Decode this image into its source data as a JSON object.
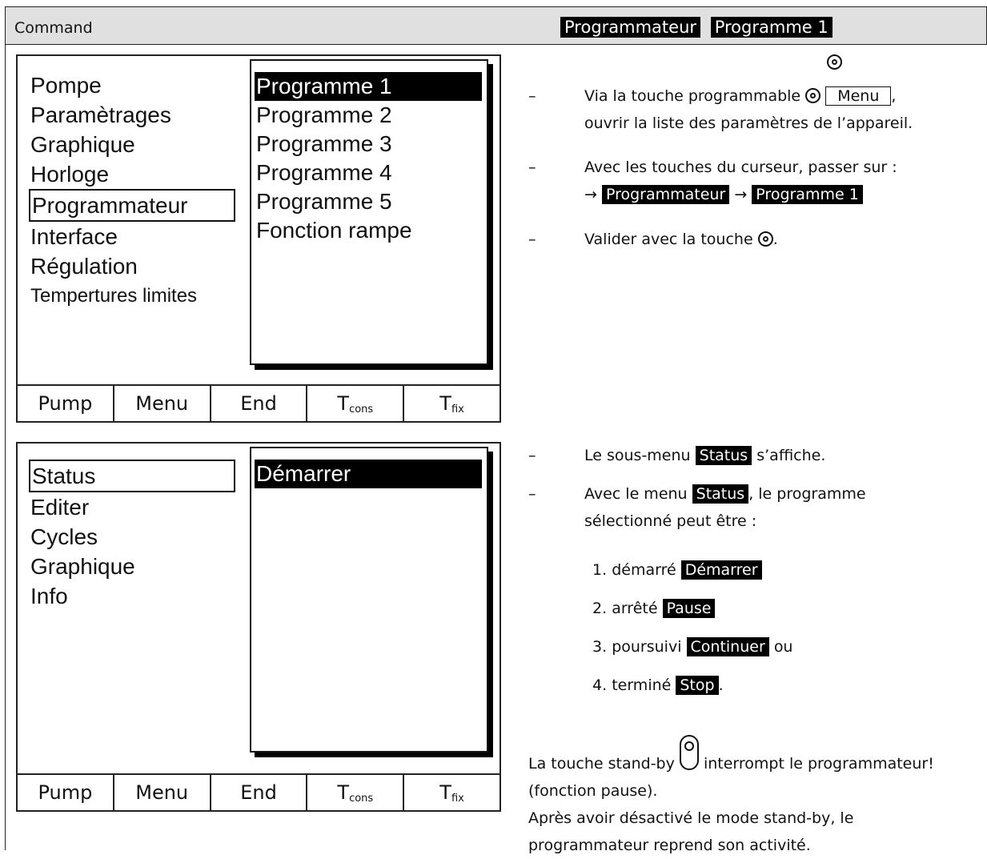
{
  "header": {
    "title": "Command",
    "path": [
      "Programmateur",
      "Programme 1"
    ]
  },
  "panel1": {
    "menu": [
      "Pompe",
      "Paramètrages",
      "Graphique",
      "Horloge",
      "Programmateur",
      "Interface",
      "Régulation",
      "Tempertures limites"
    ],
    "selected_index": 4,
    "submenu": [
      "Programme 1",
      "Programme 2",
      "Programme 3",
      "Programme 4",
      "Programme 5",
      "Fonction rampe"
    ],
    "highlighted_index": 0
  },
  "panel2": {
    "menu": [
      "Status",
      "Editer",
      "Cycles",
      "Graphique",
      "Info"
    ],
    "selected_index": 0,
    "submenu": [
      "Démarrer"
    ],
    "highlighted_index": 0
  },
  "softkeys": {
    "pump": "Pump",
    "menu": "Menu",
    "end": "End",
    "tcons_main": "T",
    "tcons_sub": "cons",
    "tfix_main": "T",
    "tfix_sub": "fix"
  },
  "instructions1": {
    "dash": "–",
    "step1_a": "Via la touche programmable",
    "step1_menu": "Menu",
    "step1_comma": ",",
    "step1_b": "ouvrir la liste des paramètres de l’appareil.",
    "step2_a": "Avec les touches du curseur, passer sur :",
    "arrow": "→",
    "step2_target1": "Programmateur",
    "step2_target2": "Programme 1",
    "step3": "Valider avec la touche",
    "step3_end": "."
  },
  "instructions2": {
    "line1_a": "Le sous-menu",
    "line1_tag": "Status",
    "line1_b": "s’affiche.",
    "line2_a": "Avec le menu",
    "line2_tag": "Status",
    "line2_b": ", le programme",
    "line3": "sélectionné peut être :",
    "items": [
      {
        "num": "1.",
        "text": "démarré",
        "tag": "Démarrer",
        "after": ""
      },
      {
        "num": "2.",
        "text": "arrêté",
        "tag": "Pause",
        "after": ""
      },
      {
        "num": "3.",
        "text": "poursuivi",
        "tag": "Continuer",
        "after": "ou"
      },
      {
        "num": "4.",
        "text": "terminé",
        "tag": "Stop",
        "after": "."
      }
    ],
    "standby_a": "La touche stand-by",
    "standby_b": "interrompt le programmateur!",
    "standby_c": "(fonction pause).",
    "standby_d": "Après avoir désactivé le mode stand-by, le",
    "standby_e": "programmateur reprend son activité."
  }
}
